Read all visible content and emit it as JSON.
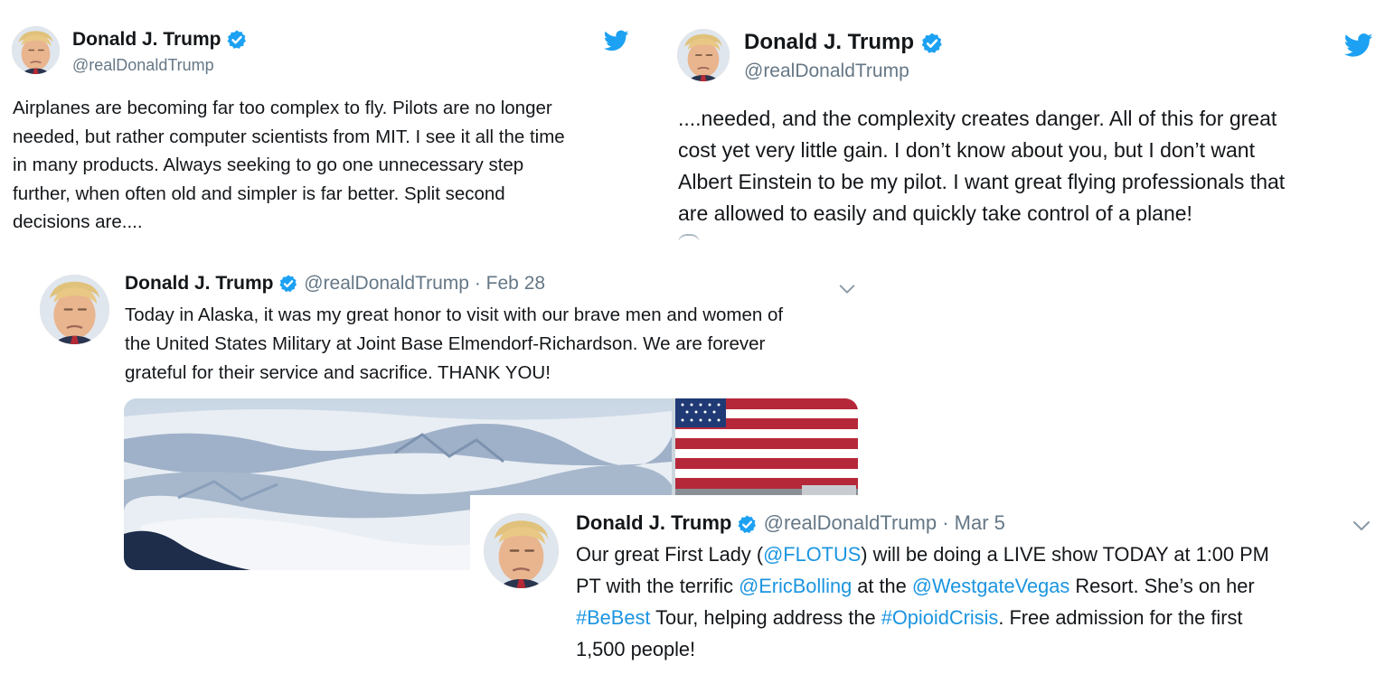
{
  "brand": {
    "twitter_blue": "#1da1f2",
    "link_color": "#1b95e0",
    "verified_color": "#1da1f2"
  },
  "tweet1": {
    "name": "Donald J. Trump",
    "handle": "@realDonaldTrump",
    "lines": [
      "Airplanes are becoming far too complex to fly. Pilots are no longer",
      "needed, but rather computer scientists from MIT. I see it all the time",
      "in many products. Always seeking to go one unnecessary step",
      "further, when often old and simpler is far better. Split second",
      "decisions are...."
    ],
    "icon": "twitter-bird-icon"
  },
  "tweet2": {
    "name": "Donald J. Trump",
    "handle": "@realDonaldTrump",
    "lines": [
      "....needed, and the complexity creates danger. All of this for great",
      "cost yet very little gain. I don’t know about you, but I don’t want",
      "Albert Einstein to be my pilot. I want great flying professionals that",
      "are allowed to easily and quickly take control of a plane!"
    ],
    "icon": "twitter-bird-icon"
  },
  "tweet3": {
    "name": "Donald J. Trump",
    "handle": "@realDonaldTrump",
    "sep": "·",
    "date": "Feb 28",
    "lines": [
      "Today in Alaska, it was my great honor to visit with our brave men and women of",
      "the United States Military at Joint Base Elmendorf-Richardson. We are forever",
      "grateful for their service and sacrifice. THANK YOU!"
    ],
    "media": [
      "snowy-mountains-aerial-photo",
      "american-flag-photo"
    ]
  },
  "tweet4": {
    "name": "Donald J. Trump",
    "handle": "@realDonaldTrump",
    "sep": "·",
    "date": "Mar 5",
    "line1": {
      "a": "Our great First Lady (",
      "m1": "@FLOTUS",
      "b": ") will be doing a LIVE show TODAY at 1:00 PM"
    },
    "line2": {
      "a": "PT with the terrific ",
      "m1": "@EricBolling",
      "b": " at the ",
      "m2": "@WestgateVegas",
      "c": " Resort. She’s on her"
    },
    "line3": {
      "h1": "#BeBest",
      "a": " Tour, helping address the ",
      "h2": "#OpioidCrisis",
      "b": ". Free admission for the first"
    },
    "line4": "1,500 people!"
  }
}
